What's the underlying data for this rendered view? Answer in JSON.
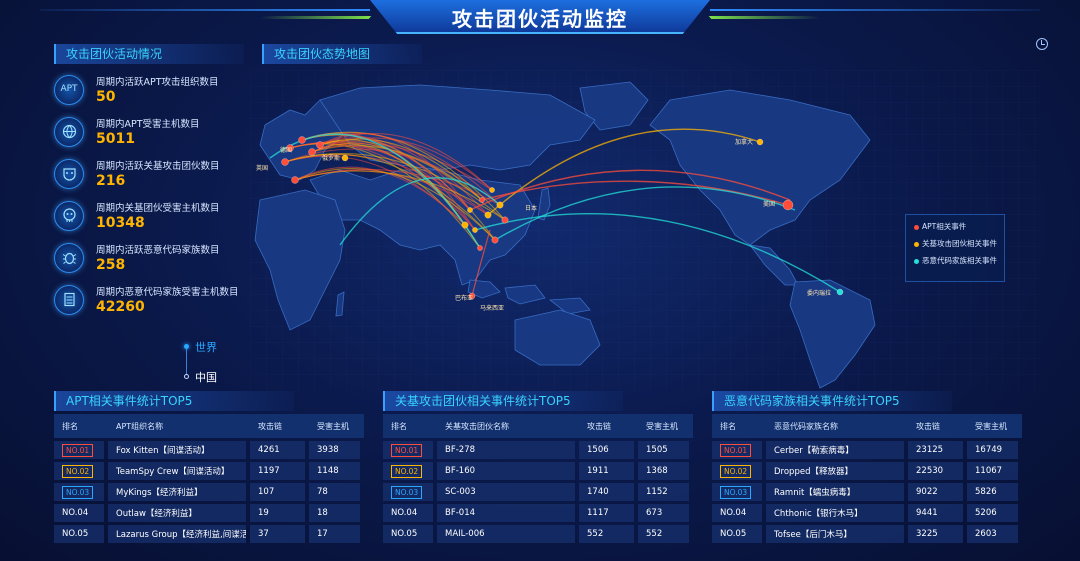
{
  "header": {
    "title": "攻击团伙活动监控"
  },
  "left_panel": {
    "title": "攻击团伙活动情况",
    "stats": [
      {
        "label": "周期内活跃APT攻击组织数目",
        "value": "50",
        "icon": "apt-icon",
        "icon_text": "APT"
      },
      {
        "label": "周期内APT受害主机数目",
        "value": "5011",
        "icon": "globe-icon"
      },
      {
        "label": "周期内活跃关基攻击团伙数目",
        "value": "216",
        "icon": "mask-icon"
      },
      {
        "label": "周期内关基团伙受害主机数目",
        "value": "10348",
        "icon": "skull-icon"
      },
      {
        "label": "周期内活跃恶意代码家族数目",
        "value": "258",
        "icon": "bug-icon"
      },
      {
        "label": "周期内恶意代码家族受害主机数目",
        "value": "42260",
        "icon": "server-icon"
      }
    ]
  },
  "scope": {
    "world": "世界",
    "china": "中国"
  },
  "map": {
    "title": "攻击团伙态势地图",
    "legend": [
      {
        "label": "APT相关事件",
        "color": "#ff4d3a"
      },
      {
        "label": "关基攻击团伙相关事件",
        "color": "#ffb400"
      },
      {
        "label": "恶意代码家族相关事件",
        "color": "#23e0d8"
      }
    ],
    "place_labels": [
      "加拿大",
      "美国",
      "英国",
      "德国",
      "俄罗斯",
      "日本",
      "委内瑞拉",
      "巴布亚",
      "马来西亚"
    ]
  },
  "tables": [
    {
      "title": "APT相关事件统计TOP5",
      "headers": [
        "排名",
        "APT组织名称",
        "攻击链",
        "受害主机"
      ],
      "rows": [
        {
          "rank": "NO.01",
          "name": "Fox Kitten【间谍活动】",
          "attack": "4261",
          "victim": "3938"
        },
        {
          "rank": "NO.02",
          "name": "TeamSpy Crew【间谍活动】",
          "attack": "1197",
          "victim": "1148"
        },
        {
          "rank": "NO.03",
          "name": "MyKings【经济利益】",
          "attack": "107",
          "victim": "78"
        },
        {
          "rank": "NO.04",
          "name": "Outlaw【经济利益】",
          "attack": "19",
          "victim": "18"
        },
        {
          "rank": "NO.05",
          "name": "Lazarus Group【经济利益,间谍活...",
          "attack": "37",
          "victim": "17"
        }
      ]
    },
    {
      "title": "关基攻击团伙相关事件统计TOP5",
      "headers": [
        "排名",
        "关基攻击团伙名称",
        "攻击链",
        "受害主机"
      ],
      "rows": [
        {
          "rank": "NO.01",
          "name": "BF-278",
          "attack": "1506",
          "victim": "1505"
        },
        {
          "rank": "NO.02",
          "name": "BF-160",
          "attack": "1911",
          "victim": "1368"
        },
        {
          "rank": "NO.03",
          "name": "SC-003",
          "attack": "1740",
          "victim": "1152"
        },
        {
          "rank": "NO.04",
          "name": "BF-014",
          "attack": "1117",
          "victim": "673"
        },
        {
          "rank": "NO.05",
          "name": "MAIL-006",
          "attack": "552",
          "victim": "552"
        }
      ]
    },
    {
      "title": "恶意代码家族相关事件统计TOP5",
      "headers": [
        "排名",
        "恶意代码家族名称",
        "攻击链",
        "受害主机"
      ],
      "rows": [
        {
          "rank": "NO.01",
          "name": "Cerber【勒索病毒】",
          "attack": "23125",
          "victim": "16749"
        },
        {
          "rank": "NO.02",
          "name": "Dropped【释放器】",
          "attack": "22530",
          "victim": "11067"
        },
        {
          "rank": "NO.03",
          "name": "Ramnit【蠕虫病毒】",
          "attack": "9022",
          "victim": "5826"
        },
        {
          "rank": "NO.04",
          "name": "Chthonic【银行木马】",
          "attack": "9441",
          "victim": "5206"
        },
        {
          "rank": "NO.05",
          "name": "Tofsee【后门木马】",
          "attack": "3225",
          "victim": "2603"
        }
      ]
    }
  ]
}
